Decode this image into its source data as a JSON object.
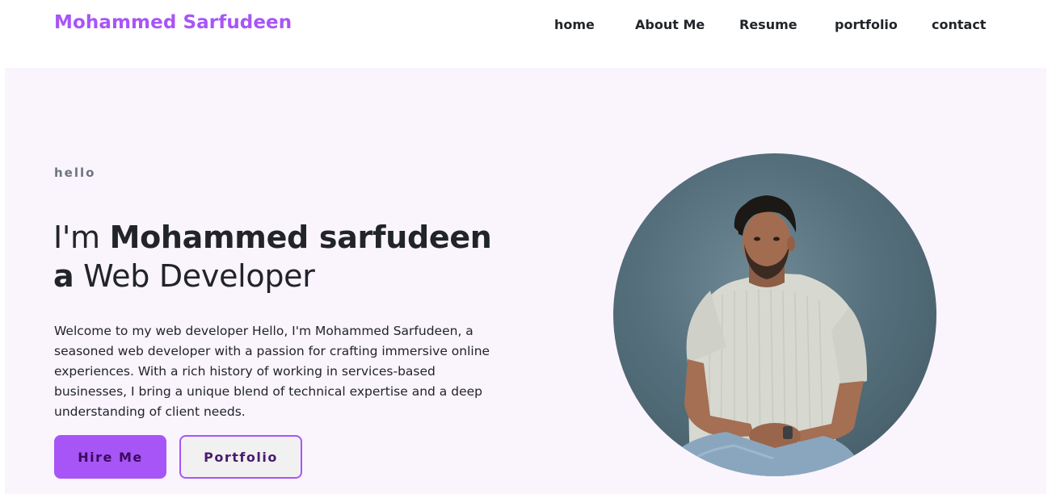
{
  "brand": {
    "name": "Mohammed Sarfudeen",
    "color": "#a855f7"
  },
  "nav": {
    "items": [
      {
        "label": "home"
      },
      {
        "label": "About Me"
      },
      {
        "label": "Resume"
      },
      {
        "label": "portfolio"
      },
      {
        "label": "contact"
      }
    ]
  },
  "hero": {
    "greeting": "hello",
    "headline": {
      "prefix": "I'm ",
      "name": "Mohammed sarfudeen",
      "article": "a",
      "role": " Web Developer"
    },
    "intro": "Welcome to my web developer Hello, I'm Mohammed Sarfudeen, a seasoned web developer with a passion for crafting immersive online experiences. With a rich history of working in services-based businesses, I bring a unique blend of technical expertise and a deep understanding of client needs.",
    "buttons": {
      "hire_label": "Hire Me",
      "portfolio_label": "Portfolio"
    },
    "portrait": {
      "icon": "profile-photo"
    },
    "background_color": "#faf4fd"
  }
}
